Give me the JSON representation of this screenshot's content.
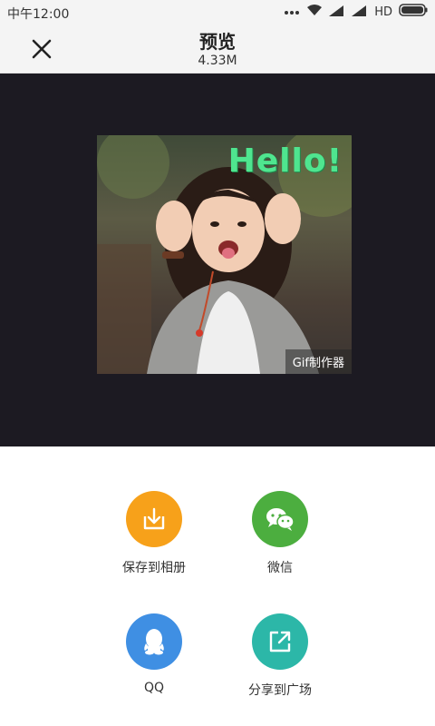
{
  "status_bar": {
    "time": "中午12:00",
    "network": "HD"
  },
  "header": {
    "title": "预览",
    "size": "4.33M"
  },
  "preview": {
    "overlay_text": "Hello!",
    "watermark": "Gif制作器"
  },
  "share": [
    {
      "label": "保存到相册",
      "color": "#f7a11a",
      "icon": "download-icon"
    },
    {
      "label": "微信",
      "color": "#4cae3f",
      "icon": "wechat-icon"
    },
    {
      "label": "QQ",
      "color": "#3f8fe3",
      "icon": "qq-icon"
    },
    {
      "label": "分享到广场",
      "color": "#2cb7a8",
      "icon": "share-out-icon"
    }
  ]
}
